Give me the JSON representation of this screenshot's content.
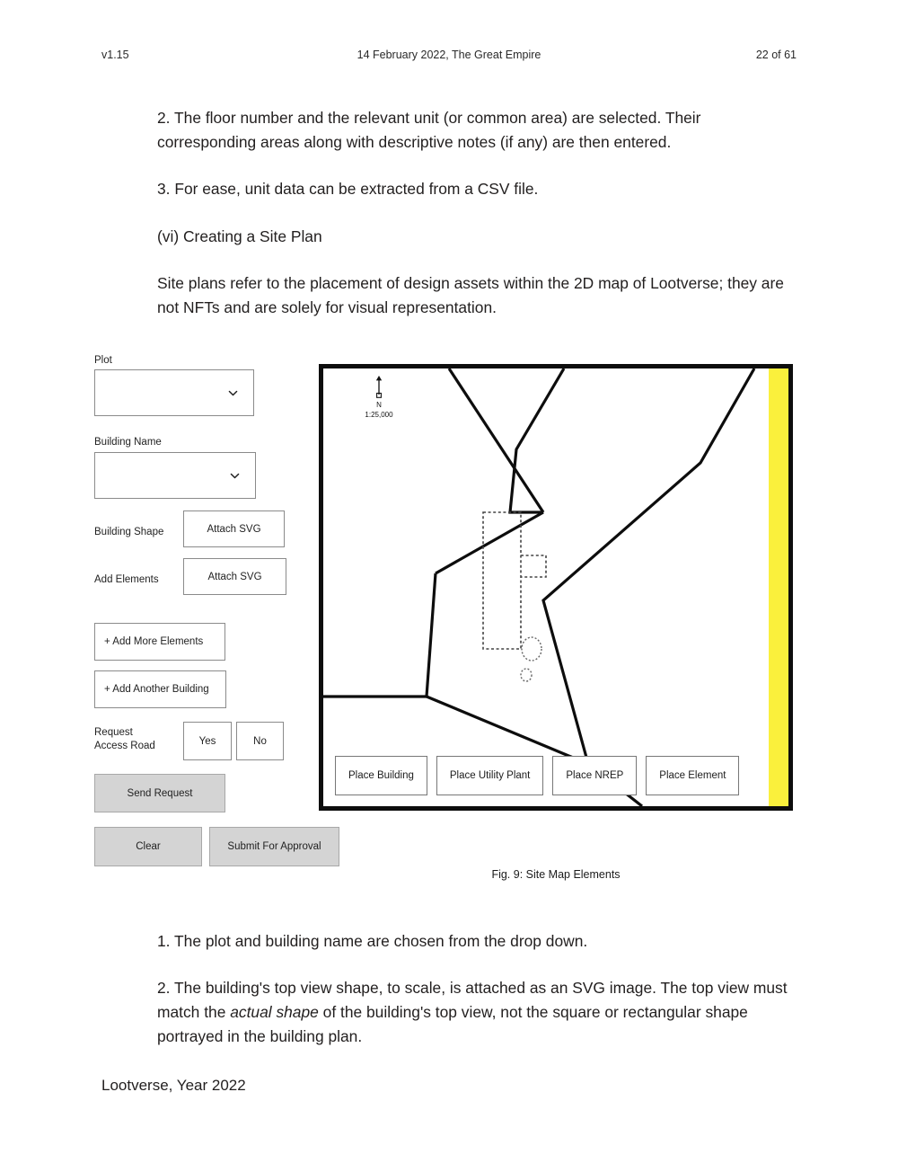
{
  "header": {
    "version": "v1.15",
    "center": "14 February 2022, The Great Empire",
    "page": "22 of 61"
  },
  "body": {
    "p1": "2. The floor number and the relevant unit (or common area) are selected. Their corresponding areas along with descriptive notes (if any) are then entered.",
    "p2": "3. For ease, unit data can be extracted from a CSV file.",
    "p3": "(vi) Creating a Site Plan",
    "p4": "Site plans refer to the placement of design assets within the 2D map of Lootverse; they are not NFTs and are solely for visual representation.",
    "p5": "1. The plot and building name are chosen from the drop down.",
    "p6_part1": "2. The building's top view shape, to scale, is attached as an SVG image. The top view must match the ",
    "p6_italic": "actual shape",
    "p6_part2": " of the building's top view, not the square or rectangular shape portrayed in the building plan."
  },
  "footer": {
    "text": "Lootverse, Year 2022"
  },
  "figure": {
    "caption": "Fig. 9: Site Map Elements",
    "form": {
      "plot_label": "Plot",
      "plot_value": "",
      "building_name_label": "Building Name",
      "building_name_value": "",
      "building_shape_label": "Building Shape",
      "building_shape_button": "Attach SVG",
      "add_elements_label": "Add Elements",
      "add_elements_button": "Attach SVG",
      "add_more_elements_button": "+ Add More Elements",
      "add_another_building_button": "+ Add Another Building",
      "request_access_road_label": "Request\nAccess Road",
      "yes_button": "Yes",
      "no_button": "No",
      "send_request_button": "Send Request",
      "clear_button": "Clear",
      "submit_button": "Submit For Approval"
    },
    "map": {
      "north_label": "N",
      "scale_label": "1:25,000",
      "place_buttons": [
        "Place Building",
        "Place Utility Plant",
        "Place NREP",
        "Place Element"
      ],
      "road_strip_color": "#faf03c",
      "border_color": "#0d0d0d"
    }
  }
}
